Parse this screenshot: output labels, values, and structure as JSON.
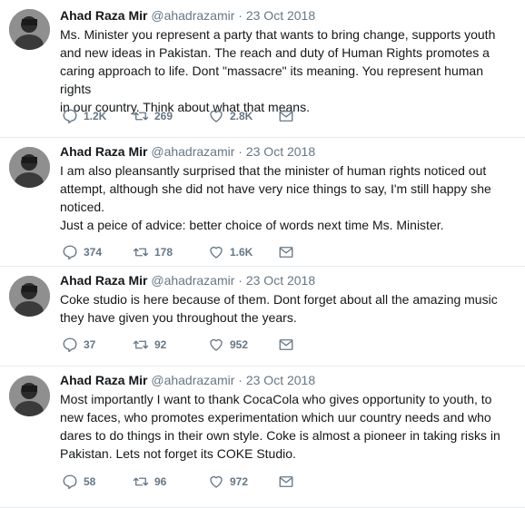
{
  "tweets": [
    {
      "name": "Ahad Raza Mir",
      "handle": "@ahadrazamir",
      "separator": "·",
      "date": "23 Oct 2018",
      "text": "Ms. Minister you represent a party that wants to bring change, supports youth\nand new ideas in Pakistan. The reach and duty of Human Rights promotes a\ncaring approach to life. Dont \"massacre\" its meaning. You represent human rights\nin our country. Think about what that means.",
      "replies": "1.2K",
      "retweets": "269",
      "likes": "2.8K"
    },
    {
      "name": "Ahad Raza Mir",
      "handle": "@ahadrazamir",
      "separator": "·",
      "date": "23 Oct 2018",
      "text": "I am also pleansantly surprised that the minister of human rights noticed out\nattempt, although she did not have very nice things to say, I'm still happy she\nnoticed.\nJust a peice of advice: better choice of words next time Ms. Minister.",
      "replies": "374",
      "retweets": "178",
      "likes": "1.6K"
    },
    {
      "name": "Ahad Raza Mir",
      "handle": "@ahadrazamir",
      "separator": "·",
      "date": "23 Oct 2018",
      "text": "Coke studio is here because of them. Dont forget about all the amazing music\nthey have given you throughout the years.",
      "replies": "37",
      "retweets": "92",
      "likes": "952"
    },
    {
      "name": "Ahad Raza Mir",
      "handle": "@ahadrazamir",
      "separator": "·",
      "date": "23 Oct 2018",
      "text": "Most importantly I want to thank CocaCola who gives opportunity to youth, to\nnew faces, who promotes experimentation which uur country needs and who\ndares to do things in their own style. Coke is almost a pioneer in taking risks in\nPakistan. Lets not forget its COKE Studio.",
      "replies": "58",
      "retweets": "96",
      "likes": "972"
    }
  ],
  "icons": {
    "reply": "reply-icon",
    "retweet": "retweet-icon",
    "like": "heart-icon",
    "message": "envelope-icon"
  },
  "colors": {
    "icon_gray": "#657786",
    "text": "#14171a",
    "divider": "#e6ecf0"
  }
}
